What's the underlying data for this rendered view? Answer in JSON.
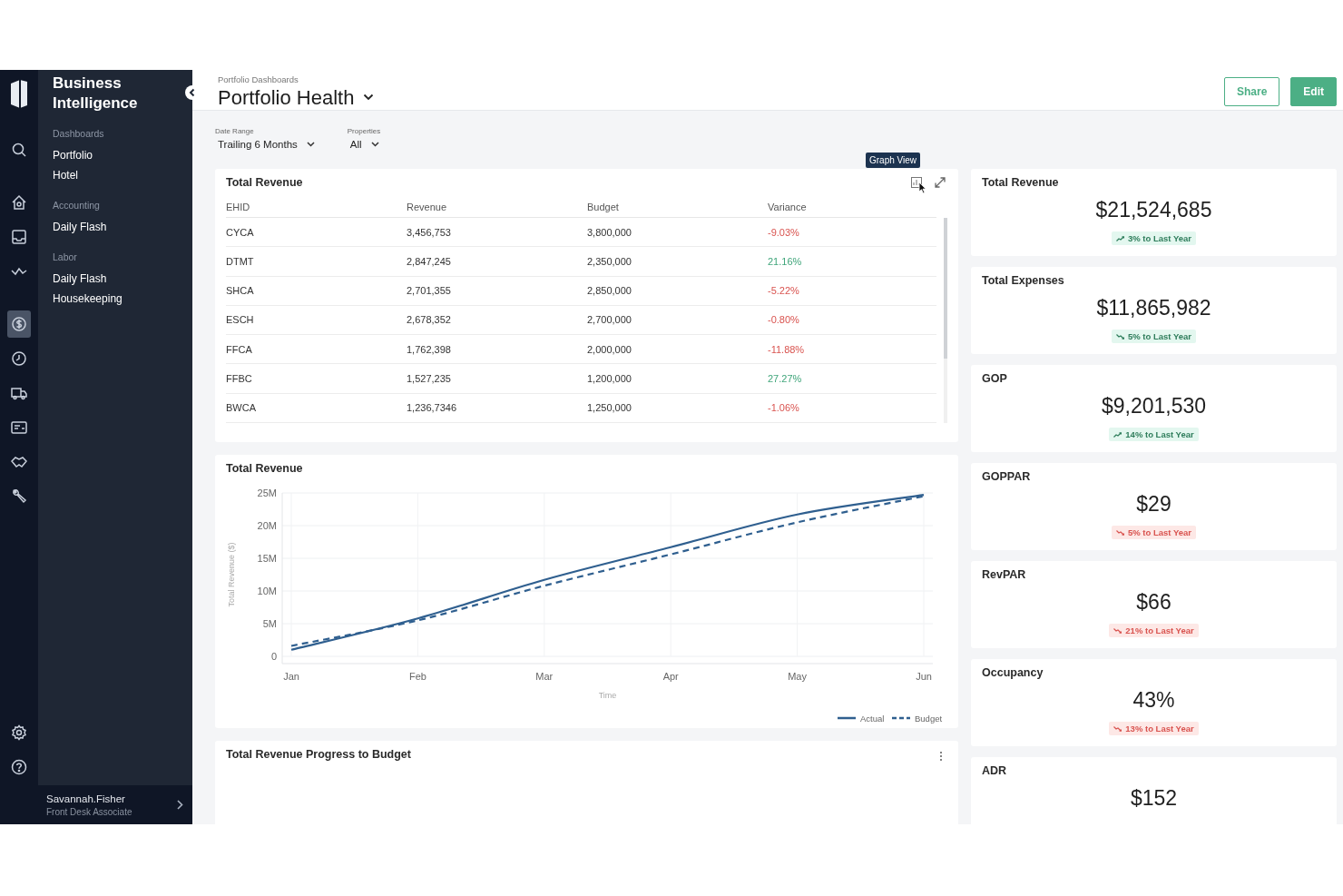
{
  "rail": {
    "top": [
      {
        "kind": "search",
        "selected": false
      },
      {
        "kind": "home",
        "selected": false
      },
      {
        "kind": "inbox",
        "selected": false
      },
      {
        "kind": "activity",
        "selected": false
      },
      {
        "kind": "dollar",
        "selected": true
      },
      {
        "kind": "clock",
        "selected": false
      },
      {
        "kind": "truck",
        "selected": false
      },
      {
        "kind": "card",
        "selected": false
      },
      {
        "kind": "handshake",
        "selected": false
      },
      {
        "kind": "wrench",
        "selected": false
      }
    ],
    "bottom": [
      {
        "kind": "settings",
        "selected": false
      },
      {
        "kind": "help",
        "selected": false
      }
    ]
  },
  "sidebar": {
    "title": "Business Intelligence",
    "sections": [
      {
        "heading": "Dashboards",
        "items": [
          "Portfolio",
          "Hotel"
        ]
      },
      {
        "heading": "Accounting",
        "items": [
          "Daily Flash"
        ]
      },
      {
        "heading": "Labor",
        "items": [
          "Daily Flash",
          "Housekeeping"
        ]
      }
    ],
    "user": {
      "name": "Savannah.Fisher",
      "role": "Front Desk Associate"
    }
  },
  "header": {
    "breadcrumb": "Portfolio Dashboards",
    "title": "Portfolio Health",
    "buttons": [
      {
        "label": "Share",
        "kind": "outline"
      },
      {
        "label": "Edit",
        "kind": "primary"
      }
    ]
  },
  "filters": [
    {
      "label": "Date Range",
      "value": "Trailing 6 Months"
    },
    {
      "label": "Properties",
      "value": "All"
    }
  ],
  "table_card": {
    "title": "Total Revenue",
    "tooltip": "Graph View",
    "columns": [
      "EHID",
      "Revenue",
      "Budget",
      "Variance"
    ],
    "rows": [
      {
        "cells": [
          "CYCA",
          "3,456,753",
          "3,800,000",
          "-9.03%"
        ],
        "positive": false
      },
      {
        "cells": [
          "DTMT",
          "2,847,245",
          "2,350,000",
          "21.16%"
        ],
        "positive": true
      },
      {
        "cells": [
          "SHCA",
          "2,701,355",
          "2,850,000",
          "-5.22%"
        ],
        "positive": false
      },
      {
        "cells": [
          "ESCH",
          "2,678,352",
          "2,700,000",
          "-0.80%"
        ],
        "positive": false
      },
      {
        "cells": [
          "FFCA",
          "1,762,398",
          "2,000,000",
          "-11.88%"
        ],
        "positive": false
      },
      {
        "cells": [
          "FFBC",
          "1,527,235",
          "1,200,000",
          "27.27%"
        ],
        "positive": true
      },
      {
        "cells": [
          "BWCA",
          "1,236,7346",
          "1,250,000",
          "-1.06%"
        ],
        "positive": false
      }
    ]
  },
  "chart_card": {
    "title": "Total Revenue",
    "chart_data": {
      "type": "line",
      "xlabel": "Time",
      "ylabel": "Total Revenue ($)",
      "categories": [
        "Jan",
        "Feb",
        "Mar",
        "Apr",
        "May",
        "Jun"
      ],
      "series": [
        {
          "name": "Actual",
          "color": "#2f5f8f",
          "line_style": "solid",
          "values": [
            1000000,
            5800000,
            11700000,
            16700000,
            21700000,
            24700000
          ]
        },
        {
          "name": "Budget",
          "color": "#2f5f8f",
          "line_style": "dashed",
          "values": [
            1600000,
            5500000,
            10800000,
            15600000,
            20500000,
            24500000
          ]
        }
      ],
      "grid": true,
      "legend": true,
      "ylim": [
        0,
        25000000
      ],
      "yticks": [
        {
          "value": 0,
          "label": "0"
        },
        {
          "value": 5000000,
          "label": "5M"
        },
        {
          "value": 10000000,
          "label": "10M"
        },
        {
          "value": 15000000,
          "label": "15M"
        },
        {
          "value": 20000000,
          "label": "20M"
        },
        {
          "value": 25000000,
          "label": "25M"
        }
      ]
    }
  },
  "progress_card": {
    "title": "Total Revenue Progress to Budget"
  },
  "kpis": [
    {
      "title": "Total Revenue",
      "value": "$21,524,685",
      "change": "3% to Last Year",
      "rising": true,
      "favorable": true
    },
    {
      "title": "Total Expenses",
      "value": "$11,865,982",
      "change": "5% to Last Year",
      "rising": false,
      "favorable": true
    },
    {
      "title": "GOP",
      "value": "$9,201,530",
      "change": "14% to Last Year",
      "rising": true,
      "favorable": true
    },
    {
      "title": "GOPPAR",
      "value": "$29",
      "change": "5% to Last Year",
      "rising": false,
      "favorable": false
    },
    {
      "title": "RevPAR",
      "value": "$66",
      "change": "21% to Last Year",
      "rising": false,
      "favorable": false
    },
    {
      "title": "Occupancy",
      "value": "43%",
      "change": "13% to Last Year",
      "rising": false,
      "favorable": false
    },
    {
      "title": "ADR",
      "value": "$152"
    }
  ]
}
